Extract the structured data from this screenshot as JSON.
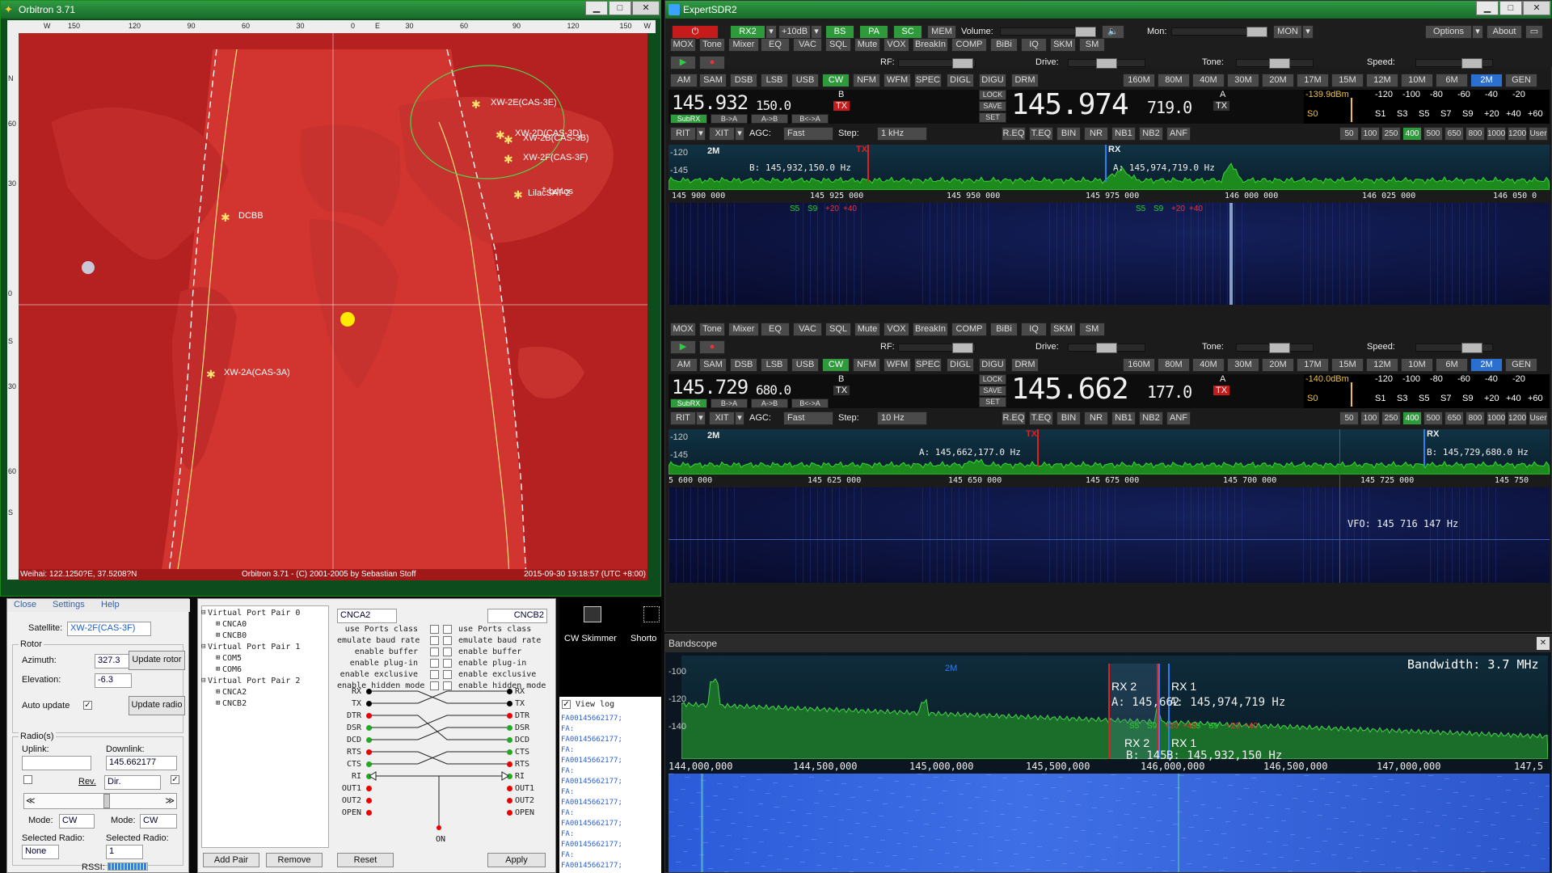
{
  "orbitron": {
    "title": "Orbitron 3.71",
    "status_left": "Weihai: 122.1250?E, 37.5208?N",
    "status_center": "Orbitron 3.71 - (C) 2001-2005 by Sebastian Stoff",
    "status_right": "2015-09-30 19:18:57 (UTC +8:00)",
    "top_scale": [
      "W",
      "150",
      "120",
      "90",
      "60",
      "30",
      "0",
      "E",
      "30",
      "60",
      "90",
      "120",
      "150",
      "W"
    ],
    "left_scale": [
      "N",
      "60",
      "30",
      "0",
      "S",
      "30",
      "60",
      "S"
    ],
    "satellites": [
      "XW-2E(CAS-3E)",
      "XW-2D(CAS-3D)",
      "XW-2B(CAS-3B)",
      "XW-2F(CAS-3F)",
      "LilacSAT-2",
      "DCBB",
      "XW-2A(CAS-3A)"
    ],
    "station_label": "bd4os",
    "menu": [
      "Close",
      "Settings",
      "Help"
    ],
    "satellite_label": "Satellite:",
    "satellite_value": "XW-2F(CAS-3F)",
    "rotor_title": "Rotor",
    "azimuth_label": "Azimuth:",
    "azimuth_value": "327.3",
    "elevation_label": "Elevation:",
    "elevation_value": "-6.3",
    "update_rotor": "Update rotor",
    "auto_update": "Auto update",
    "update_radio": "Update radio",
    "radio_title": "Radio(s)",
    "uplink_label": "Uplink:",
    "uplink_value": "",
    "downlink_label": "Downlink:",
    "downlink_value": "145.662177",
    "rev_label": "Rev.",
    "dir_value": "Dir.",
    "mode_label": "Mode:",
    "mode_up": "CW",
    "mode_down": "CW",
    "selected_radio_label": "Selected Radio:",
    "selected_radio_1": "None",
    "selected_radio_2": "1",
    "rssi_label": "RSSI:"
  },
  "vspe": {
    "tree": [
      "Virtual Port Pair 0",
      "CNCA0",
      "CNCB0",
      "Virtual Port Pair 1",
      "COM5",
      "COM6",
      "Virtual Port Pair 2",
      "CNCA2",
      "CNCB2"
    ],
    "port_a": "CNCA2",
    "port_b": "CNCB2",
    "options": [
      "use Ports class",
      "emulate baud rate",
      "enable buffer",
      "enable plug-in",
      "enable exclusive",
      "enable hidden mode"
    ],
    "signals_left": [
      "RX",
      "TX",
      "DTR",
      "DSR",
      "DCD",
      "RTS",
      "CTS",
      "RI",
      "OUT1",
      "OUT2",
      "OPEN"
    ],
    "signals_right": [
      "RX",
      "TX",
      "DTR",
      "DSR",
      "DCD",
      "CTS",
      "RTS",
      "RI",
      "OUT1",
      "OUT2",
      "OPEN"
    ],
    "on_label": "ON",
    "btn_add": "Add Pair",
    "btn_remove": "Remove",
    "btn_reset": "Reset",
    "btn_apply": "Apply"
  },
  "tools": {
    "cw_skimmer": "CW Skimmer",
    "shortcut": "Shorto",
    "view_log": "View log",
    "log_lines": [
      "FA00145662177;",
      "FA:",
      "FA00145662177;",
      "FA:",
      "FA00145662177;",
      "FA:",
      "FA00145662177;",
      "FA:",
      "FA00145662177;",
      "FA:",
      "FA00145662177;",
      "FA:",
      "FA00145662177;",
      "FA:",
      "FA00145662177;"
    ]
  },
  "sdr": {
    "title": "ExpertSDR2",
    "top": {
      "rx2": "RX2",
      "plus10": "+10dB",
      "bs": "BS",
      "pa": "PA",
      "sc": "SC",
      "mem": "MEM",
      "volume": "Volume:",
      "mon_label": "Mon:",
      "mon_btn": "MON",
      "options": "Options",
      "about": "About"
    },
    "row_btns": [
      "MOX",
      "Tone",
      "Mixer",
      "EQ",
      "VAC",
      "SQL",
      "Mute",
      "VOX",
      "BreakIn",
      "COMP",
      "BiBi",
      "IQ",
      "SKM",
      "SM"
    ],
    "rf_label": "RF:",
    "drive_label": "Drive:",
    "tone_label": "Tone:",
    "speed_label": "Speed:",
    "modes": [
      "AM",
      "SAM",
      "DSB",
      "LSB",
      "USB",
      "CW",
      "NFM",
      "WFM",
      "SPEC",
      "DIGL",
      "DIGU",
      "DRM"
    ],
    "bands": [
      "160M",
      "80M",
      "40M",
      "30M",
      "20M",
      "17M",
      "15M",
      "12M",
      "10M",
      "6M",
      "2M",
      "GEN"
    ],
    "meter_scale_top": [
      "-120",
      "-100",
      "-80",
      "-60",
      "-40",
      "-20"
    ],
    "meter_scale_bot": [
      "S1",
      "S3",
      "S5",
      "S7",
      "S9",
      "+20",
      "+40",
      "+60"
    ],
    "vfo_small_btns": [
      "SubRX",
      "B->A",
      "A->B",
      "B<->A"
    ],
    "lock_btns": [
      "LOCK",
      "SAVE",
      "SET"
    ],
    "rit": "RIT",
    "xit": "XIT",
    "agc_label": "AGC:",
    "agc_value": "Fast",
    "step_label": "Step:",
    "filters": [
      "50",
      "100",
      "250",
      "400",
      "500",
      "650",
      "800",
      "1000",
      "1200",
      "User"
    ],
    "dsp_btns": [
      "R.EQ",
      "T.EQ",
      "BIN",
      "NR",
      "NB1",
      "NB2",
      "ANF"
    ],
    "rx1": {
      "vfo_b_big": "145.932",
      "vfo_b_small": "150.0",
      "vfo_a_big": "145.974",
      "vfo_a_small": "719.0",
      "dbm": "-139.9dBm",
      "step_value": "1 kHz",
      "band_tag": "2M",
      "tx_tag": "TX",
      "rx_tag": "RX",
      "b_freq": "B: 145,932,150.0 Hz",
      "a_freq": "A: 145,974,719.0 Hz",
      "s0": "S0",
      "scale": [
        "-120",
        "-145"
      ],
      "freq_axis": [
        "145 900 000",
        "145 925 000",
        "145 950 000",
        "145 975 000",
        "146 000 000",
        "146 025 000",
        "146 050 0"
      ],
      "s_marks": [
        "S5",
        "S9",
        "+20",
        "+40"
      ]
    },
    "rx2": {
      "vfo_b_big": "145.729",
      "vfo_b_small": "680.0",
      "vfo_a_big": "145.662",
      "vfo_a_small": "177.0",
      "dbm": "-140.0dBm",
      "step_value": "10 Hz",
      "band_tag": "2M",
      "tx_tag": "TX",
      "rx_tag": "RX",
      "a_freq": "A: 145,662,177.0 Hz",
      "b_freq": "B: 145,729,680.0 Hz",
      "s0": "S0",
      "scale": [
        "-120",
        "-145"
      ],
      "freq_axis": [
        "5 600 000",
        "145 625 000",
        "145 650 000",
        "145 675 000",
        "145 700 000",
        "145 725 000",
        "145 750"
      ],
      "vfo_cursor": "VFO: 145 716 147 Hz"
    }
  },
  "bandscope": {
    "title": "Bandscope",
    "bandwidth": "Bandwidth: 3.7 MHz",
    "band_tag": "2M",
    "scale": [
      "-100",
      "-120",
      "-140"
    ],
    "rx2_tag": "RX 2",
    "rx1_tag": "RX 1",
    "rx2_a": "A: 145,662",
    "rx1_a": "A: 145,974,719 Hz",
    "rx2_b": "B: 145,",
    "rx1_b": "B: 145,932,150 Hz",
    "freq_axis": [
      "144,000,000",
      "144,500,000",
      "145,000,000",
      "145,500,000",
      "146,000,000",
      "146,500,000",
      "147,000,000",
      "147,5"
    ],
    "s_marks": [
      "S5",
      "S9",
      "+20",
      "+40"
    ]
  },
  "colors": {
    "accent_green": "#2e9a3c",
    "blue": "#2b6fd0",
    "red": "#c61b1b",
    "map_red": "#b21e1e"
  }
}
